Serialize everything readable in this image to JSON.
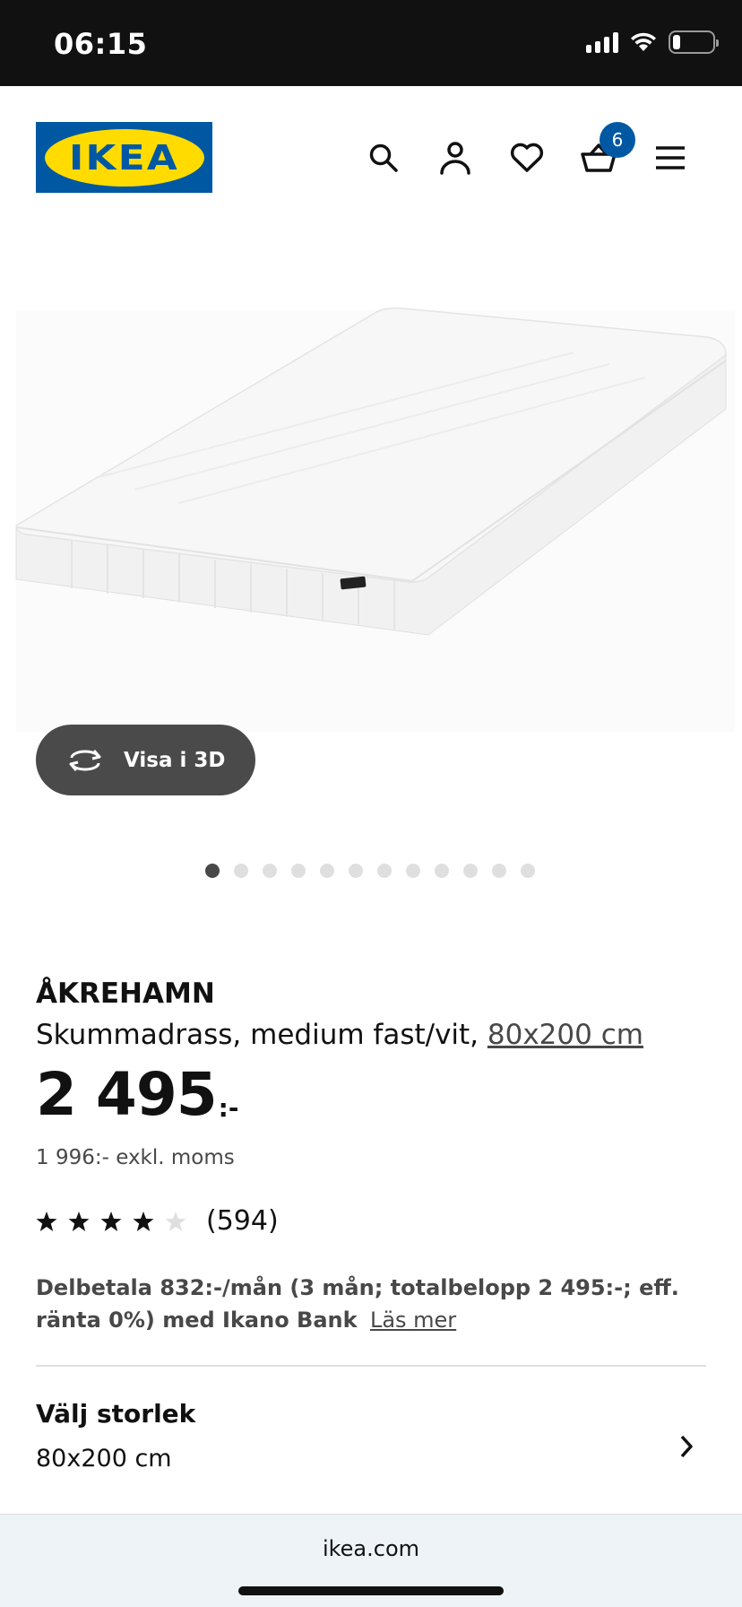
{
  "status_bar": {
    "time": "06:15",
    "battery_level": 0.2
  },
  "header": {
    "logo_text": "IKEA",
    "icons": [
      "search-icon",
      "profile-icon",
      "heart-icon",
      "cart-icon",
      "menu-icon"
    ],
    "cart_count": "6"
  },
  "colors": {
    "brand_blue": "#0058a3",
    "brand_yellow": "#ffdb00",
    "text_dark": "#111111",
    "text_muted": "#484848"
  },
  "gallery": {
    "view_3d_label": "Visa i 3D",
    "dot_count": 12,
    "active_dot_index": 0
  },
  "product": {
    "name": "ÅKREHAMN",
    "description": "Skummadrass, medium fast/vit, ",
    "size_link": "80x200 cm",
    "price_main": "2 495",
    "price_suffix": ":-",
    "price_excl_vat": "1 996:- exkl. moms",
    "rating_stars": 4,
    "rating_max": 5,
    "rating_count": "(594)",
    "financing_text": "Delbetala 832:-/mån (3 mån; totalbelopp 2 495:-; eff. ränta 0%) med Ikano Bank",
    "financing_link": "Läs mer"
  },
  "size_selector": {
    "title": "Välj storlek",
    "value": "80x200 cm"
  },
  "browser": {
    "url": "ikea.com"
  }
}
